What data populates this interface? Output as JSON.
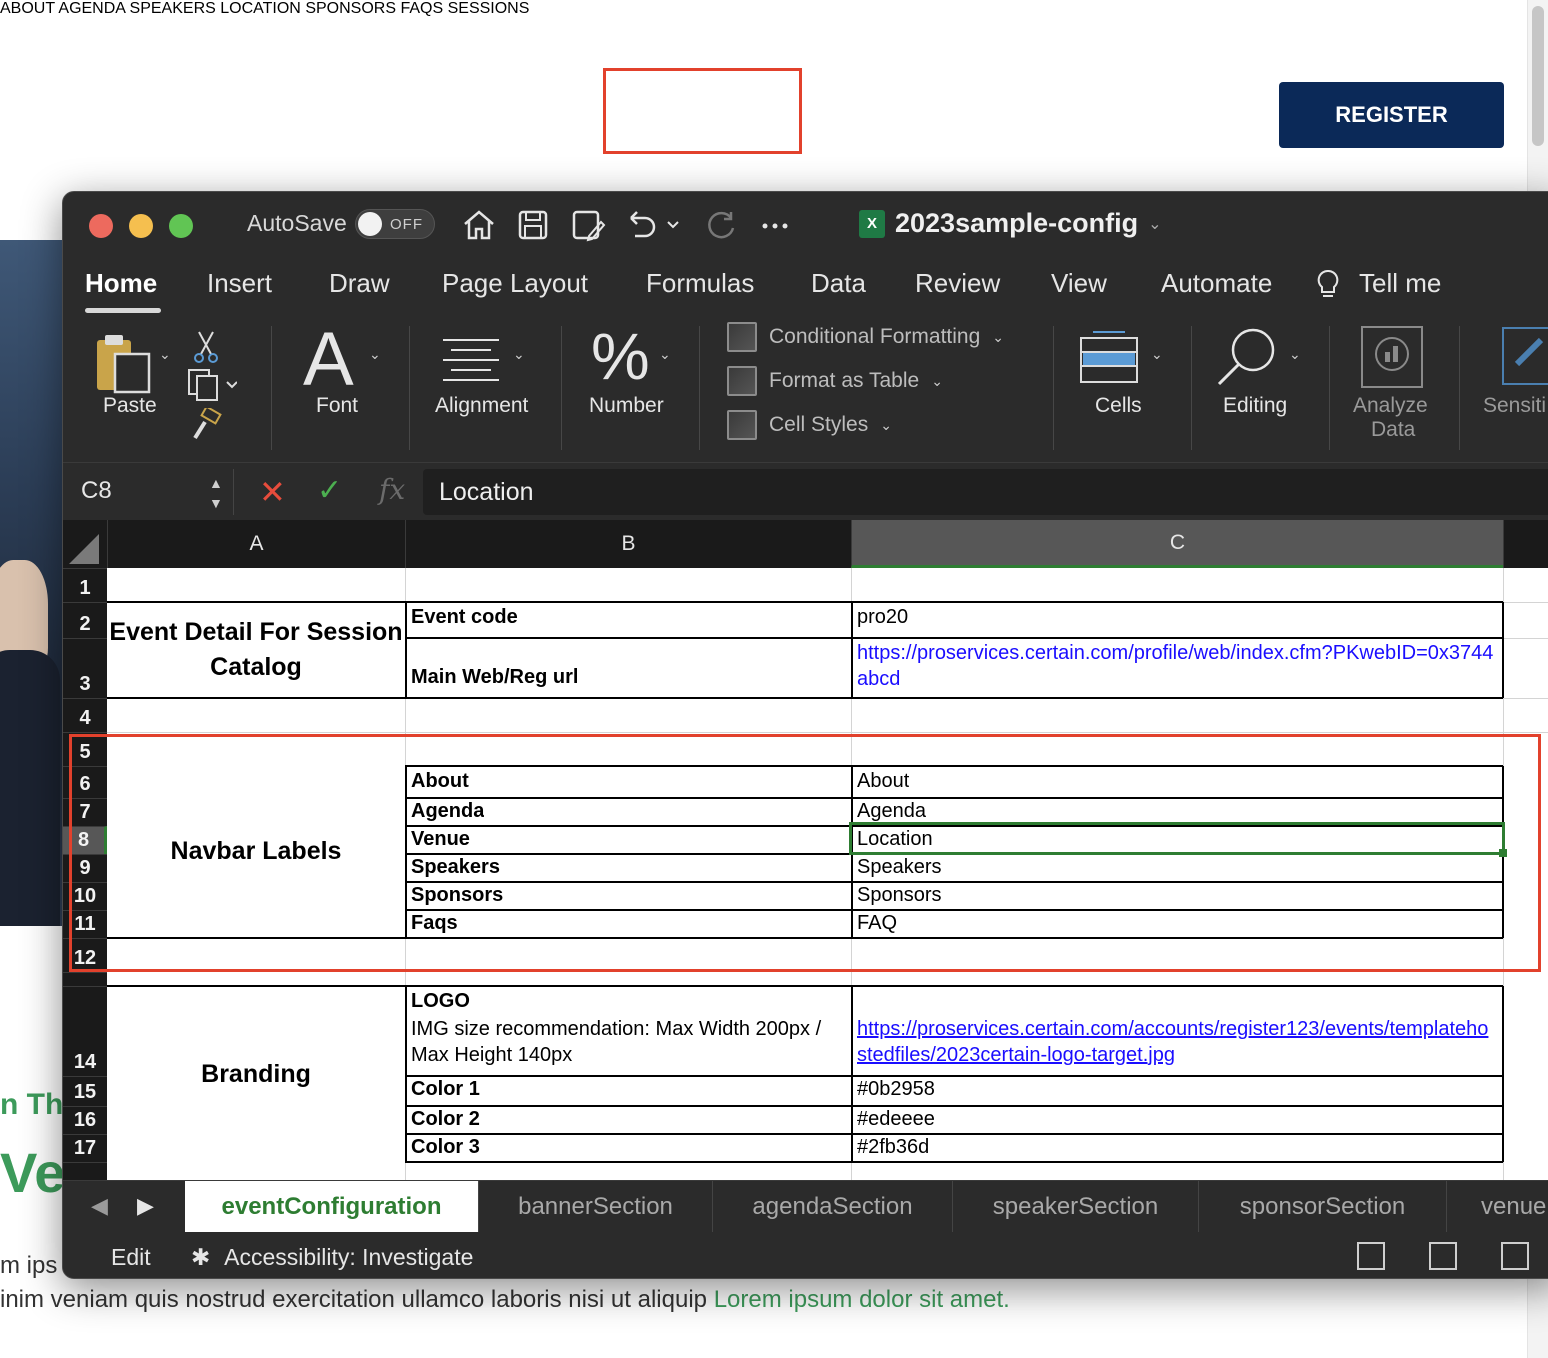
{
  "website": {
    "nav": [
      "ABOUT",
      "AGENDA",
      "SPEAKERS",
      "LOCATION",
      "SPONSORS",
      "FAQS",
      "SESSIONS"
    ],
    "register": "REGISTER",
    "green_small": "n Th",
    "green_big": "Vel",
    "text_line1": "m ips",
    "text_line2": "inim veniam quis nostrud exercitation ullamco laboris nisi ut aliquip",
    "text_line2_link": "Lorem ipsum dolor sit amet."
  },
  "excel": {
    "autosave_label": "AutoSave",
    "autosave_state": "OFF",
    "title": "2023sample-config",
    "tabs": [
      "Home",
      "Insert",
      "Draw",
      "Page Layout",
      "Formulas",
      "Data",
      "Review",
      "View",
      "Automate",
      "Tell me"
    ],
    "ribbon": {
      "paste": "Paste",
      "font": "Font",
      "alignment": "Alignment",
      "number": "Number",
      "conditional_formatting": "Conditional Formatting",
      "format_as_table": "Format as Table",
      "cell_styles": "Cell Styles",
      "cells": "Cells",
      "editing": "Editing",
      "analyze_data_1": "Analyze",
      "analyze_data_2": "Data",
      "sensitivity": "Sensiti"
    },
    "name_box": "C8",
    "formula_value": "Location",
    "columns": [
      "A",
      "B",
      "C"
    ],
    "rows": [
      "1",
      "2",
      "3",
      "4",
      "5",
      "6",
      "7",
      "8",
      "9",
      "10",
      "11",
      "12",
      "14",
      "15",
      "16",
      "17"
    ],
    "cells": {
      "a_event_detail": "Event Detail For Session Catalog",
      "b2": "Event code",
      "c2": "pro20",
      "b3": "Main Web/Reg url",
      "c3": "https://proservices.certain.com/profile/web/index.cfm?PKwebID=0x3744abcd",
      "a_navbar": "Navbar Labels",
      "b6": "About",
      "c6": "About",
      "b7": "Agenda",
      "c7": "Agenda",
      "b8": "Venue",
      "c8": "Location",
      "b9": "Speakers",
      "c9": "Speakers",
      "b10": "Sponsors",
      "c10": "Sponsors",
      "b11": "Faqs",
      "c11": "FAQ",
      "a_branding": "Branding",
      "b14_title": "LOGO",
      "b14_desc": "IMG size recommendation: Max Width 200px / Max Height 140px",
      "c14": "https://proservices.certain.com/accounts/register123/events/templatehostedfiles/2023certain-logo-target.jpg",
      "b15": "Color 1",
      "c15": "#0b2958",
      "b16": "Color 2",
      "c16": "#edeeee",
      "b17": "Color 3",
      "c17": "#2fb36d"
    },
    "sheet_tabs": [
      "eventConfiguration",
      "bannerSection",
      "agendaSection",
      "speakerSection",
      "sponsorSection",
      "venue"
    ],
    "status": {
      "mode": "Edit",
      "accessibility": "Accessibility: Investigate"
    }
  },
  "colors": {
    "register_bg": "#0b2958",
    "highlight_red": "#e2412c",
    "selection_green": "#2e7d32",
    "link_blue": "#1a0dff"
  }
}
